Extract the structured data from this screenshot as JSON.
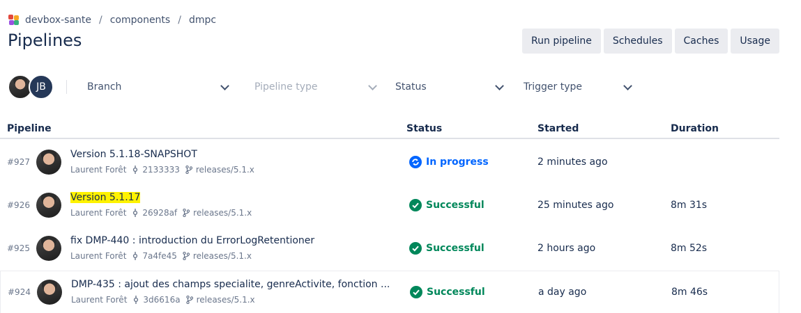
{
  "breadcrumb": {
    "workspace": "devbox-sante",
    "sep": "/",
    "project": "components",
    "repo": "dmpc"
  },
  "page_title": "Pipelines",
  "actions": {
    "run": "Run pipeline",
    "schedules": "Schedules",
    "caches": "Caches",
    "usage": "Usage"
  },
  "filters": {
    "avatar_initials": "JB",
    "branch": "Branch",
    "pipeline_type": "Pipeline type",
    "status": "Status",
    "trigger_type": "Trigger type"
  },
  "table": {
    "headers": {
      "pipeline": "Pipeline",
      "status": "Status",
      "started": "Started",
      "duration": "Duration"
    },
    "rows": [
      {
        "num": "#927",
        "title": "Version 5.1.18-SNAPSHOT",
        "author": "Laurent Forêt",
        "commit": "2133333",
        "branch": "releases/5.1.x",
        "status": "In progress",
        "started": "2 minutes ago",
        "duration": ""
      },
      {
        "num": "#926",
        "title": "Version 5.1.17",
        "author": "Laurent Forêt",
        "commit": "26928af",
        "branch": "releases/5.1.x",
        "status": "Successful",
        "started": "25 minutes ago",
        "duration": "8m 31s"
      },
      {
        "num": "#925",
        "title": "fix DMP-440 : introduction du ErrorLogRetentioner",
        "author": "Laurent Forêt",
        "commit": "7a4fe45",
        "branch": "releases/5.1.x",
        "status": "Successful",
        "started": "2 hours ago",
        "duration": "8m 52s"
      },
      {
        "num": "#924",
        "title": "DMP-435 : ajout des champs specialite, genreActivite, fonction ...",
        "author": "Laurent Forêt",
        "commit": "3d6616a",
        "branch": "releases/5.1.x",
        "status": "Successful",
        "started": "a day ago",
        "duration": "8m 46s"
      }
    ]
  },
  "colors": {
    "in_progress": "#0065ff",
    "success": "#00875a",
    "highlight": "#fff200"
  },
  "icons": {
    "status_in_progress": "refresh-circle-icon",
    "status_success": "check-circle-icon",
    "commit": "commit-icon",
    "branch": "branch-icon"
  }
}
